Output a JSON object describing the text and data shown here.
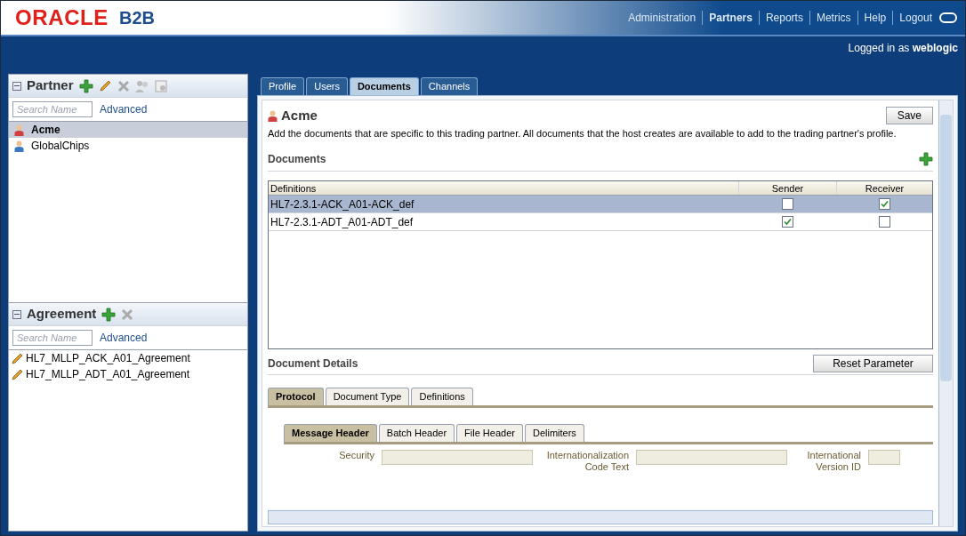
{
  "header": {
    "logo": "ORACLE",
    "product": "B2B",
    "nav": [
      {
        "label": "Administration",
        "selected": false
      },
      {
        "label": "Partners",
        "selected": true
      },
      {
        "label": "Reports",
        "selected": false
      },
      {
        "label": "Metrics",
        "selected": false
      },
      {
        "label": "Help",
        "selected": false
      },
      {
        "label": "Logout",
        "selected": false
      }
    ],
    "login_prefix": "Logged in as",
    "login_user": "weblogic"
  },
  "partner_panel": {
    "title": "Partner",
    "search": {
      "placeholder": "Search Name"
    },
    "advanced": "Advanced",
    "items": [
      {
        "label": "Acme",
        "selected": true,
        "color": "#d04040"
      },
      {
        "label": "GlobalChips",
        "selected": false,
        "color": "#3a78c0"
      }
    ]
  },
  "agreement_panel": {
    "title": "Agreement",
    "search": {
      "placeholder": "Search Name"
    },
    "advanced": "Advanced",
    "items": [
      {
        "label": "HL7_MLLP_ACK_A01_Agreement"
      },
      {
        "label": "HL7_MLLP_ADT_A01_Agreement"
      }
    ]
  },
  "tabs": [
    {
      "label": "Profile",
      "selected": false
    },
    {
      "label": "Users",
      "selected": false
    },
    {
      "label": "Documents",
      "selected": true
    },
    {
      "label": "Channels",
      "selected": false
    }
  ],
  "partner_name": "Acme",
  "save": "Save",
  "description": "Add the documents that are specific to this trading partner. All documents that the host creates are available to add to the trading partner's profile.",
  "documents": {
    "title": "Documents",
    "columns": [
      "Definitions",
      "Sender",
      "Receiver"
    ],
    "rows": [
      {
        "definition": "HL7-2.3.1-ACK_A01-ACK_def",
        "sender": false,
        "receiver": true,
        "selected": true
      },
      {
        "definition": "HL7-2.3.1-ADT_A01-ADT_def",
        "sender": true,
        "receiver": false,
        "selected": false
      }
    ]
  },
  "document_details": {
    "title": "Document Details",
    "reset": "Reset Parameter",
    "tabs": [
      {
        "label": "Protocol",
        "selected": true
      },
      {
        "label": "Document Type",
        "selected": false
      },
      {
        "label": "Definitions",
        "selected": false
      }
    ],
    "subtabs": [
      {
        "label": "Message Header",
        "selected": true
      },
      {
        "label": "Batch Header",
        "selected": false
      },
      {
        "label": "File Header",
        "selected": false
      },
      {
        "label": "Delimiters",
        "selected": false
      }
    ],
    "fields": [
      {
        "label": "Security"
      },
      {
        "label": "Internationalization Code Text"
      },
      {
        "label": "International Version ID"
      }
    ]
  }
}
